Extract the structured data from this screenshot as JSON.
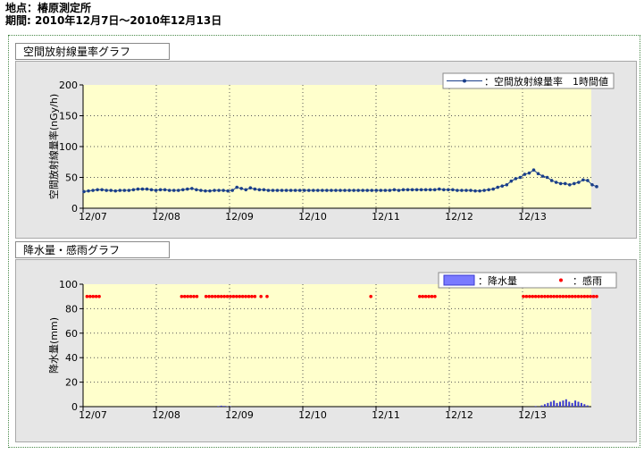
{
  "header": {
    "location": "地点：椿原測定所",
    "period": "期間: 2010年12月7日～2010年12月13日"
  },
  "colors": {
    "plot_bg": "#ffffcc",
    "dose_series": "#1a3f8a",
    "precip_series": "#7a7aff",
    "rain_sense": "#ff0000"
  },
  "chart_data": [
    {
      "type": "line",
      "title": "空間放射線量率グラフ",
      "ylabel": "空間放射線量率(nGy/h)",
      "ylim": [
        0,
        200
      ],
      "yticks": [
        "200",
        "150",
        "100",
        "50",
        "0"
      ],
      "xticks": [
        "12/07",
        "12/08",
        "12/09",
        "12/10",
        "12/11",
        "12/12",
        "12/13"
      ],
      "grid": true,
      "legend_position": "top-right",
      "series": [
        {
          "name": "：空間放射線量率　1時間値",
          "x_hours_from_1207": [
            0,
            2,
            4,
            6,
            8,
            10,
            12,
            14,
            16,
            18,
            20,
            22,
            24,
            26,
            28,
            30,
            32,
            34,
            36,
            38,
            40,
            42,
            44,
            46,
            48,
            50,
            52,
            54,
            56,
            58,
            60,
            62,
            64,
            66,
            68,
            70,
            72,
            74,
            76,
            78,
            80,
            82,
            84,
            86,
            88,
            90,
            92,
            94,
            96,
            98,
            100,
            102,
            104,
            106,
            108,
            110,
            112,
            114,
            116,
            118,
            120,
            122,
            124,
            126,
            128,
            130,
            132,
            134,
            136,
            138,
            140,
            142,
            144,
            146,
            148,
            150,
            152,
            154,
            156,
            158,
            160,
            162,
            164,
            166,
            168
          ],
          "values": [
            27,
            28,
            29,
            30,
            30,
            29,
            29,
            28,
            29,
            29,
            29,
            30,
            31,
            31,
            31,
            30,
            29,
            30,
            30,
            29,
            29,
            29,
            30,
            31,
            32,
            30,
            29,
            28,
            28,
            29,
            29,
            29,
            28,
            29,
            34,
            32,
            30,
            33,
            31,
            30,
            30,
            29,
            29,
            29,
            29,
            29,
            29,
            29,
            29,
            29,
            29,
            29,
            29,
            29,
            29,
            29,
            29,
            29,
            29,
            29,
            29,
            29,
            29,
            29,
            29,
            29,
            29,
            29,
            29,
            30,
            29,
            30,
            30,
            30,
            30,
            30,
            30,
            30,
            30,
            31,
            30,
            30,
            30,
            29,
            29,
            29,
            29,
            28,
            28,
            29,
            30,
            31,
            34,
            36,
            38,
            44,
            48,
            50,
            55,
            57,
            62,
            56,
            52,
            50,
            45,
            42,
            40,
            40,
            38,
            40,
            42,
            46,
            45,
            38,
            35
          ]
        }
      ]
    },
    {
      "type": "bar",
      "title": "降水量・感雨グラフ",
      "ylabel": "降水量(mm)",
      "ylim": [
        0,
        100
      ],
      "yticks": [
        "100",
        "80",
        "60",
        "40",
        "20",
        "0"
      ],
      "xticks": [
        "12/07",
        "12/08",
        "12/09",
        "12/10",
        "12/11",
        "12/12",
        "12/13"
      ],
      "grid": true,
      "legend_position": "top-right",
      "series": [
        {
          "name": "：降水量",
          "kind": "bar",
          "x_hours_from_1207": [
            44,
            45,
            46,
            47,
            48,
            148,
            150,
            151,
            152,
            153,
            154,
            155,
            156,
            157,
            158,
            159,
            160,
            161,
            162,
            163,
            164,
            165
          ],
          "values": [
            0.5,
            0.8,
            0.6,
            0.4,
            0.3,
            0.5,
            1,
            2,
            3,
            4,
            5,
            3,
            4,
            5,
            6,
            4,
            3,
            5,
            4,
            3,
            2,
            1
          ]
        },
        {
          "name": "：感雨",
          "kind": "scatter",
          "value": 90,
          "x_hours_from_1207": [
            1,
            2,
            3,
            4,
            5,
            32,
            33,
            34,
            35,
            36,
            37,
            40,
            41,
            42,
            43,
            44,
            45,
            46,
            47,
            48,
            49,
            50,
            51,
            52,
            53,
            54,
            55,
            56,
            58,
            60,
            94,
            110,
            111,
            112,
            113,
            114,
            115,
            144,
            145,
            146,
            147,
            148,
            149,
            150,
            151,
            152,
            153,
            154,
            155,
            156,
            157,
            158,
            159,
            160,
            161,
            162,
            163,
            164,
            165,
            166,
            167,
            168
          ]
        }
      ]
    }
  ]
}
